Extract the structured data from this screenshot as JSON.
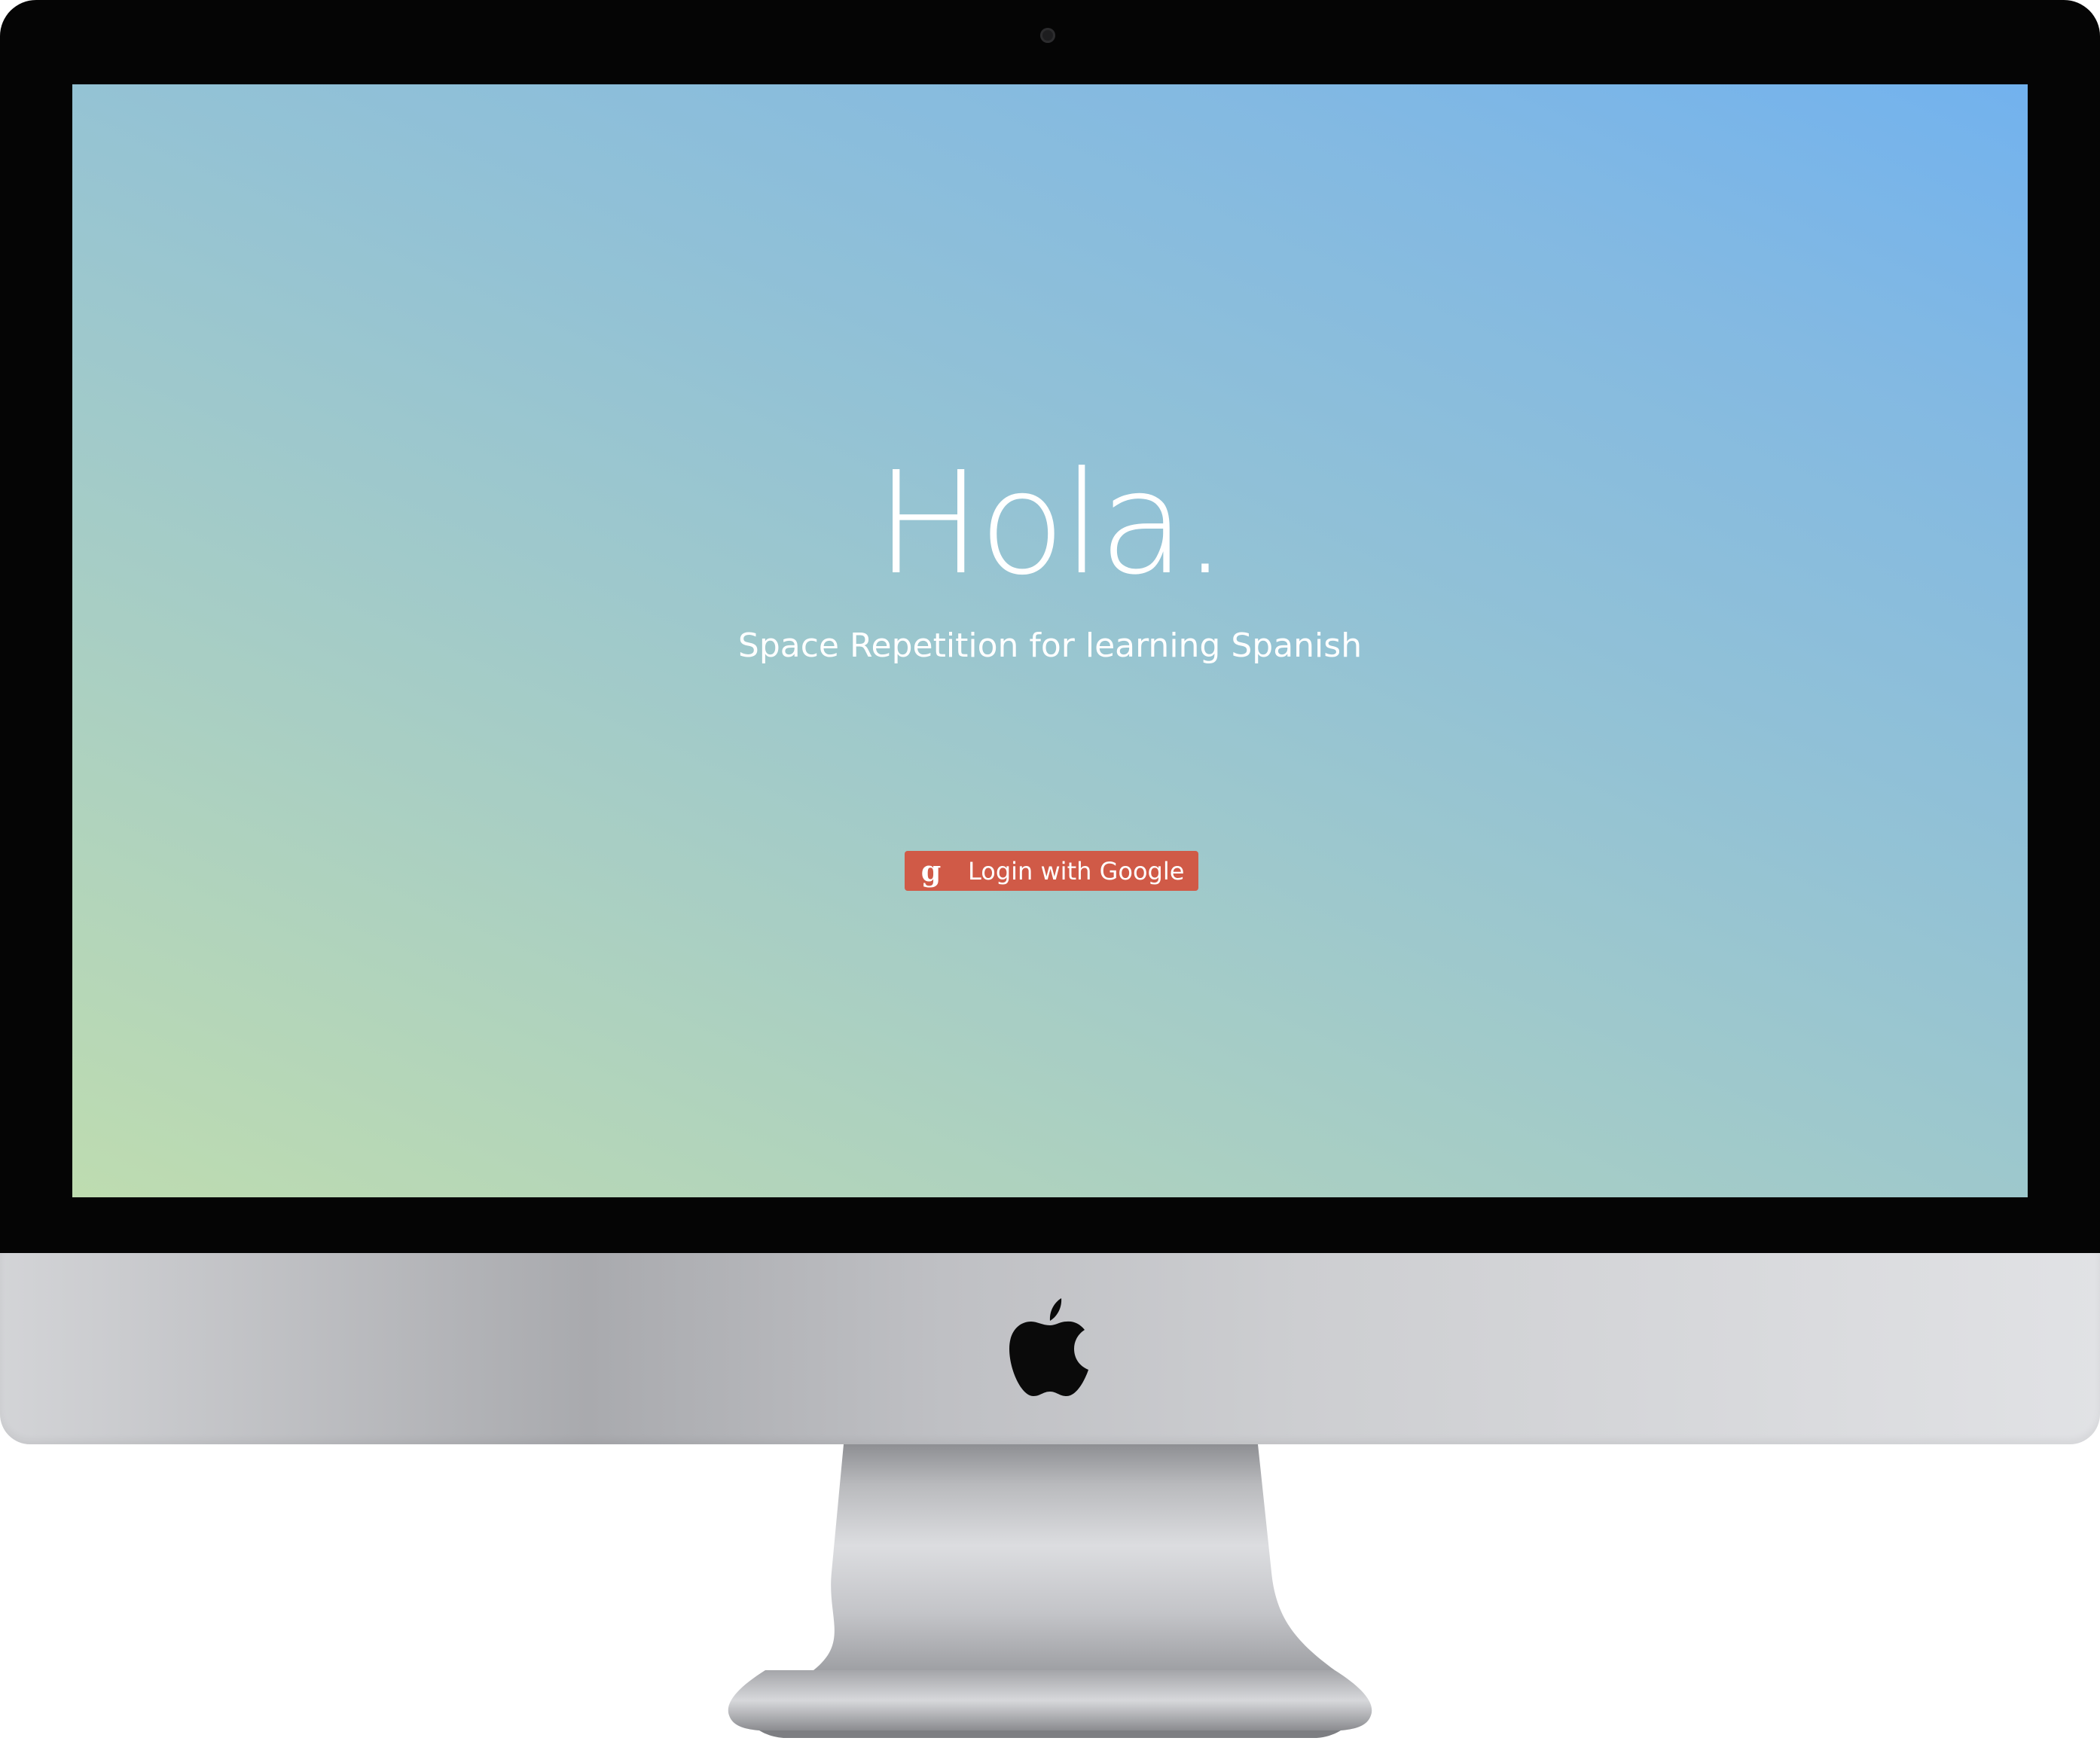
{
  "app": {
    "title": "Hola.",
    "subtitle": "Space Repetition for learning Spanish"
  },
  "login": {
    "icon_glyph": "g",
    "label": "Login with Google",
    "color": "#d05a47"
  },
  "theme": {
    "gradient_colors": [
      "#bedcb0",
      "#a8cec4",
      "#93c2d5",
      "#83b9e2",
      "#72b2ee"
    ],
    "text_color": "#ffffff"
  },
  "icons": {
    "login": "google-plus-icon",
    "brand": "apple-logo-icon"
  }
}
